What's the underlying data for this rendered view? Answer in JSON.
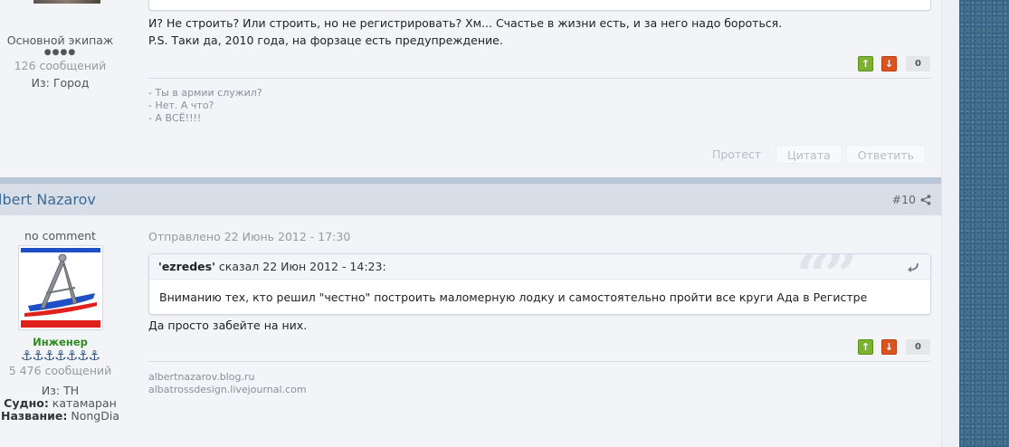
{
  "post1": {
    "author": {
      "rank": "Основной экипаж",
      "pips": "●●●●",
      "posts": "126 сообщений",
      "from_label": "Из:",
      "from_value": "Город"
    },
    "text_lines": [
      "И? Не строить? Или строить, но не регистрировать? Хм... Счастье в жизни есть, и за него надо бороться.",
      "P.S. Таки да, 2010 года, на форзаце есть предупреждение."
    ],
    "votes": {
      "up": "↑",
      "down": "↓",
      "count": "0"
    },
    "signature": [
      "- Ты в армии служил?",
      "- Нет. А  что?",
      "- А ВСЁ!!!!"
    ],
    "actions": {
      "report": "Протест",
      "quote": "Цитата",
      "reply": "Ответить"
    }
  },
  "post2": {
    "author_name": "lbert Nazarov",
    "post_number": "#10",
    "author": {
      "status": "no comment",
      "rank": "Инженер",
      "anchors": "⚓⚓⚓⚓⚓⚓⚓",
      "posts": "5 476 сообщений",
      "from_label": "Из:",
      "from_value": "ТН",
      "vessel_label": "Судно:",
      "vessel_value": "катамаран",
      "name_label": "Название:",
      "name_value": "NongDia"
    },
    "date": "Отправлено 22 Июнь 2012 - 17:30",
    "quote": {
      "author": "'ezredes'",
      "said": "сказал 22 Июн 2012 - 14:23:",
      "marks": "“”",
      "body": "Вниманию тех, кто решил \"честно\" построить маломерную лодку и самостоятельно пройти все круги Ада в Регистре"
    },
    "text": "Да просто забейте на них.",
    "votes": {
      "up": "↑",
      "down": "↓",
      "count": "0"
    },
    "signature": [
      "albertnazarov.blog.ru",
      "albatrossdesign.livejournal.com"
    ]
  },
  "colors": {
    "link_blue": "#3d6a94",
    "vote_up": "#7bb32e",
    "vote_down": "#d9541e",
    "rank_green": "#2e8b1e",
    "sidebar_bg": "#3f6e8e"
  }
}
